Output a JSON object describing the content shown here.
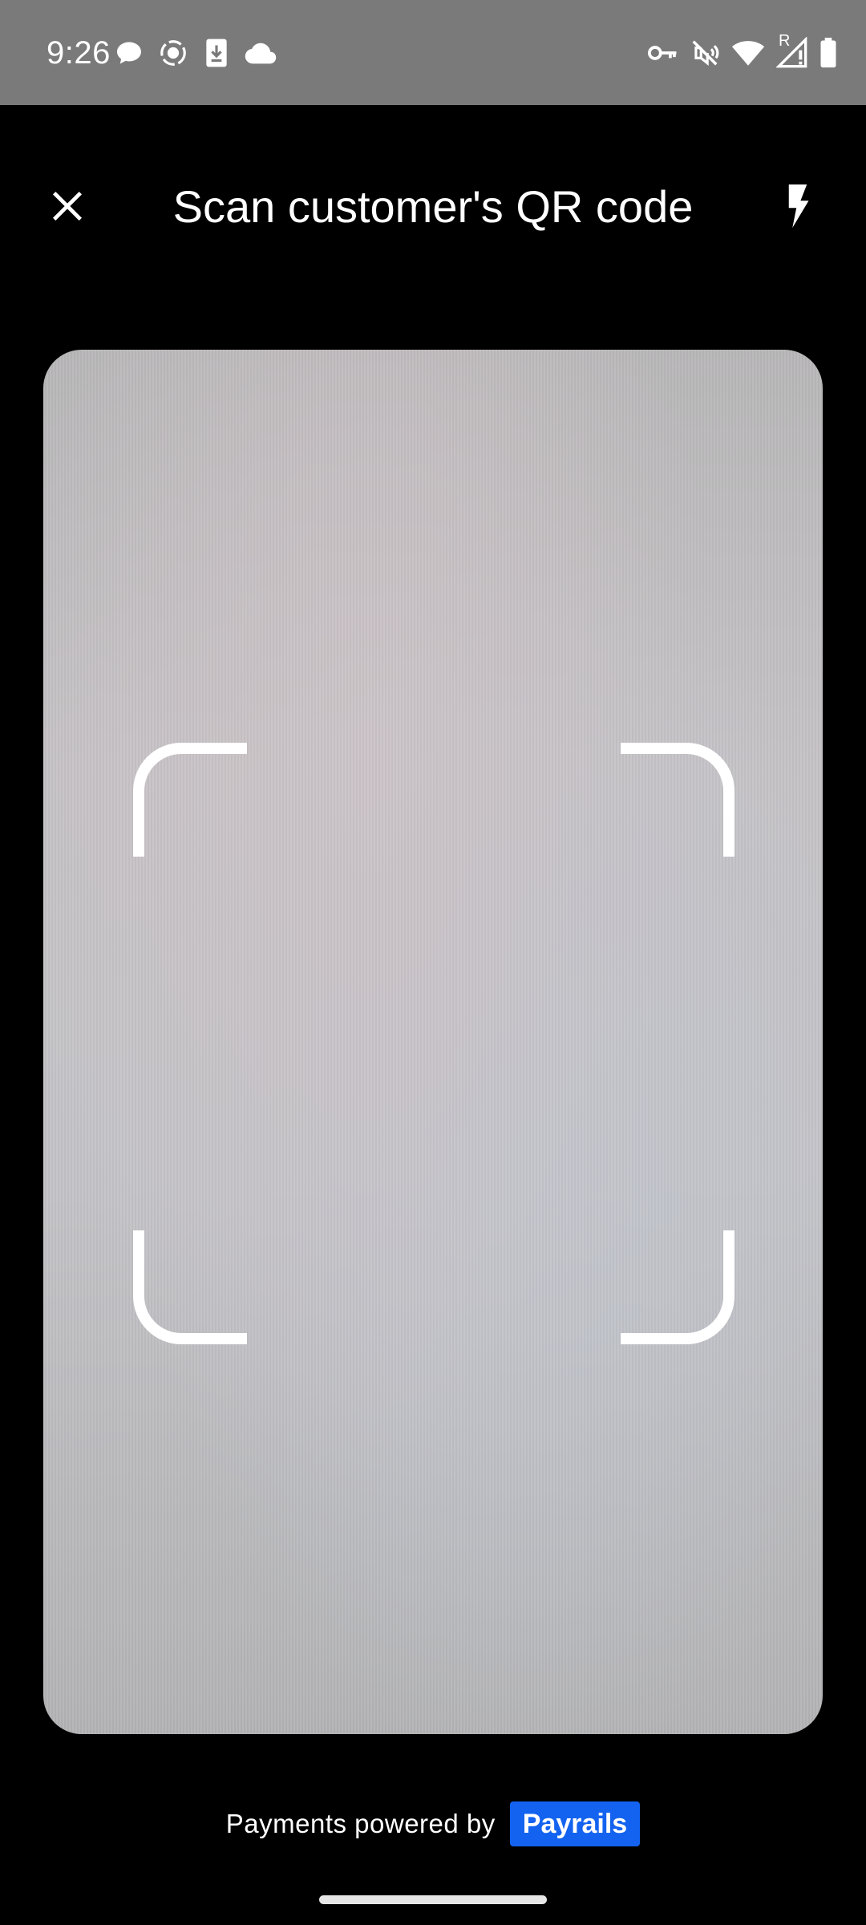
{
  "status_bar": {
    "time": "9:26",
    "left_icons": [
      "chat-bubble-icon",
      "screen-record-icon",
      "download-icon",
      "cloud-icon"
    ],
    "right_icons": [
      "vpn-key-icon",
      "vibrate-off-icon",
      "wifi-icon",
      "signal-roaming-icon",
      "battery-icon"
    ],
    "roaming_label": "R"
  },
  "header": {
    "title": "Scan customer's QR code",
    "close_icon": "close-icon",
    "flash_icon": "flash-icon"
  },
  "scanner": {
    "frame_color": "#ffffff"
  },
  "footer": {
    "powered_by_text": "Payments powered by",
    "brand_name": "Payrails",
    "brand_color": "#1363f0"
  },
  "colors": {
    "status_bar_bg": "#7a7a7a",
    "page_bg": "#000000"
  }
}
